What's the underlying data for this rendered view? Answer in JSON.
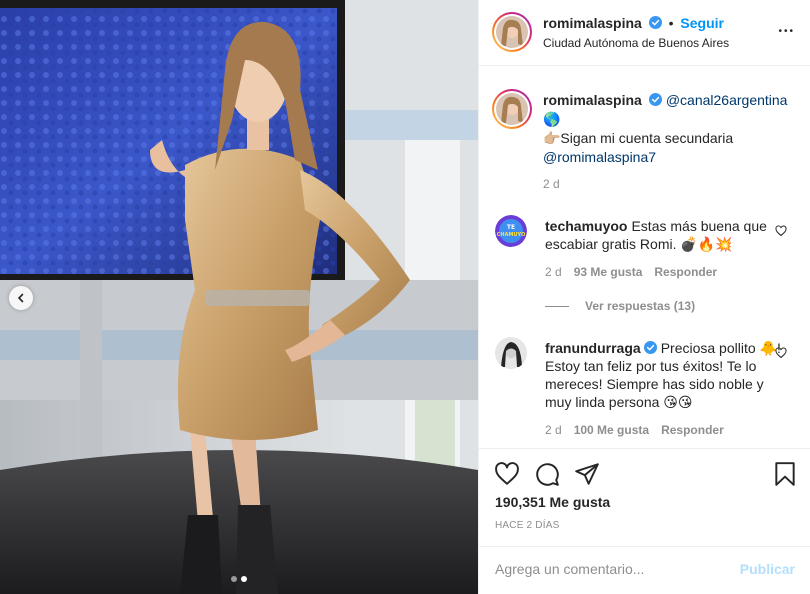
{
  "colors": {
    "accent": "#0095f6",
    "verified": "#3897f0",
    "secondary_text": "#8e8e8e"
  },
  "header": {
    "username": "romimalaspina",
    "separator": "•",
    "follow_label": "Seguir",
    "location": "Ciudad Autónoma de Buenos Aires",
    "more_label": "•••"
  },
  "caption": {
    "username": "romimalaspina",
    "mention": "@canal26argentina",
    "line1_emoji": "🌎",
    "line2": "👉🏼Sigan mi cuenta secundaria",
    "line3_mention": "@romimalaspina7",
    "time": "2 d"
  },
  "comments": [
    {
      "username": "techamuyoo",
      "text": "Estas más buena que escabiar gratis Romi. 💣🔥💥",
      "time": "2 d",
      "likes": "93 Me gusta",
      "reply_label": "Responder",
      "view_replies": "Ver respuestas (13)"
    },
    {
      "username": "franundurraga",
      "text": "Preciosa pollito 🐥! Estoy tan feliz por tus éxitos! Te lo mereces! Siempre has sido noble y muy linda persona 😘😘",
      "time": "2 d",
      "likes": "100 Me gusta",
      "reply_label": "Responder"
    }
  ],
  "actions": {
    "icons": [
      "heart-icon",
      "comment-icon",
      "share-icon",
      "bookmark-icon"
    ],
    "likes_count": "190,351 Me gusta",
    "timestamp": "HACE 2 DÍAS"
  },
  "add_comment": {
    "placeholder": "Agrega un comentario...",
    "publish_label": "Publicar"
  },
  "media": {
    "carousel_total": 2,
    "carousel_active": 1
  }
}
